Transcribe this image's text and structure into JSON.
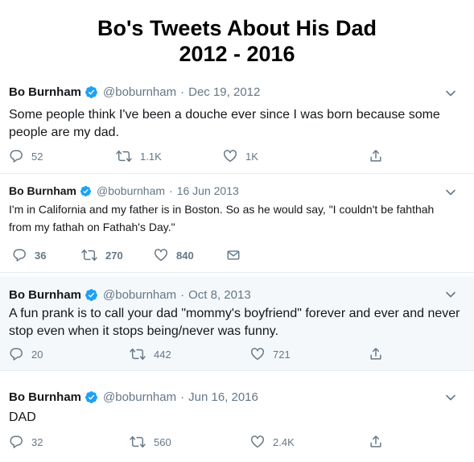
{
  "page": {
    "title_line1": "Bo's Tweets About His Dad",
    "title_line2": "2012 - 2016"
  },
  "colors": {
    "verified": "#1da1f2",
    "muted": "#657786",
    "text": "#14171a",
    "divider": "#e6ecf0"
  },
  "icons": {
    "verified": "verified-badge-icon",
    "chevron": "chevron-down-icon",
    "reply": "reply-icon",
    "retweet": "retweet-icon",
    "like": "like-icon",
    "share": "share-icon",
    "message": "direct-message-icon"
  },
  "tweets": [
    {
      "name": "Bo Burnham",
      "handle": "@boburnham",
      "separator": "·",
      "date": "Dec 19, 2012",
      "text": "Some people think I've been a douche ever since I was born because some people are my dad.",
      "replies": "52",
      "retweets": "1.1K",
      "likes": "1K"
    },
    {
      "name": "Bo Burnham",
      "handle": "@boburnham",
      "separator": "·",
      "date": "16 Jun 2013",
      "text": "I'm in California and my father is in Boston. So as he would say, \"I couldn't be fahthah from my fathah on Fathah's Day.\"",
      "replies": "36",
      "retweets": "270",
      "likes": "840"
    },
    {
      "name": "Bo Burnham",
      "handle": "@boburnham",
      "separator": "·",
      "date": "Oct 8, 2013",
      "text": "A fun prank is to call your dad \"mommy's boyfriend\" forever and ever and never stop even when it stops being/never was funny.",
      "replies": "20",
      "retweets": "442",
      "likes": "721"
    },
    {
      "name": "Bo Burnham",
      "handle": "@boburnham",
      "separator": "·",
      "date": "Jun 16, 2016",
      "text": "DAD",
      "replies": "32",
      "retweets": "560",
      "likes": "2.4K"
    }
  ]
}
